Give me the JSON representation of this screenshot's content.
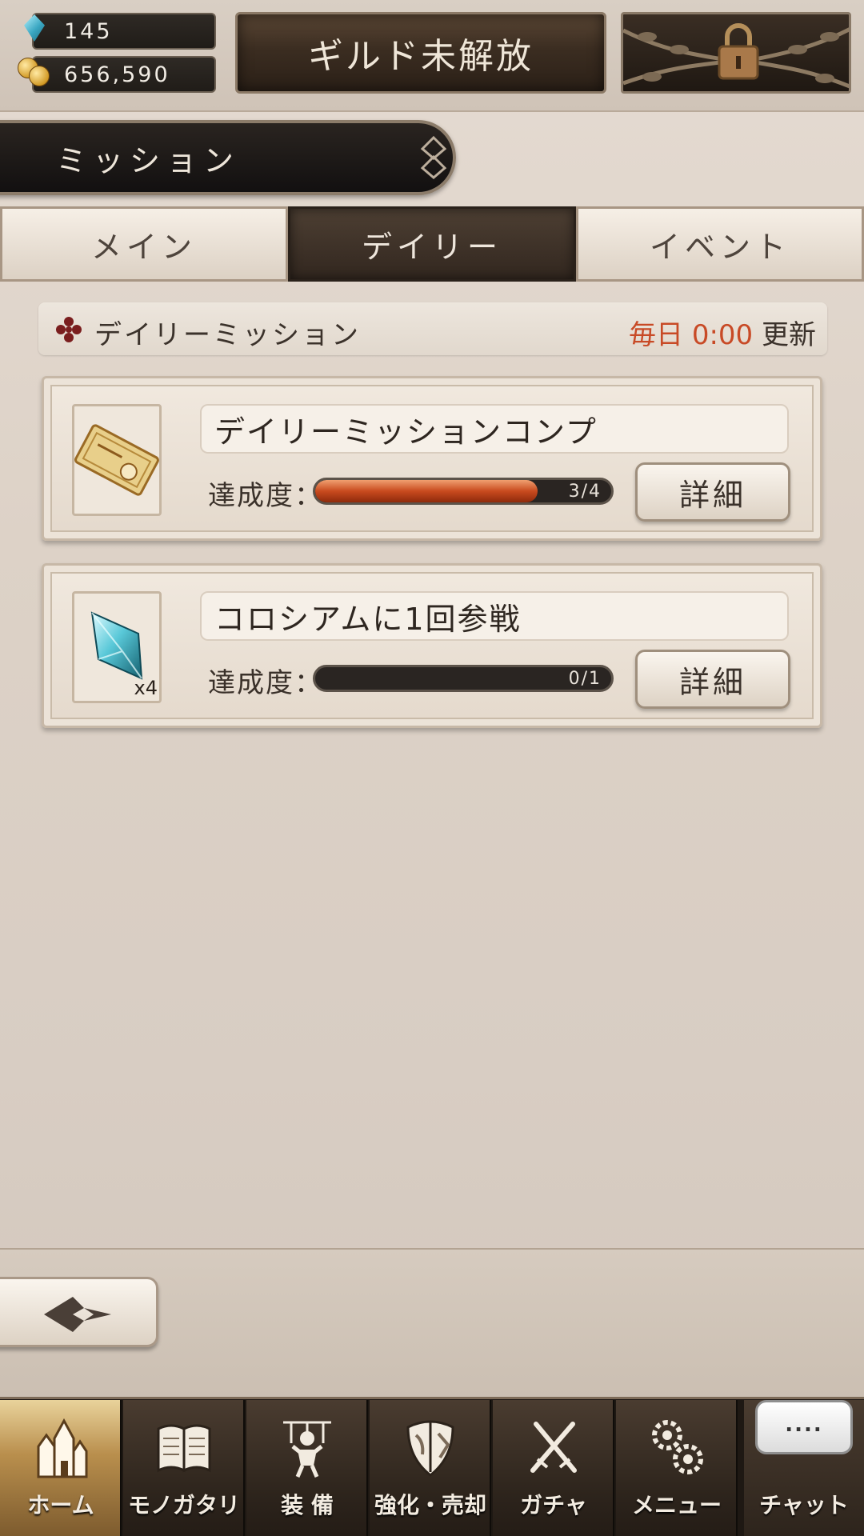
{
  "header": {
    "gems": "145",
    "coins": "656,590",
    "guild_button_label": "ギルド未解放"
  },
  "mission_header": {
    "title": "ミッション"
  },
  "tabs": [
    {
      "label": "メイン",
      "active": false
    },
    {
      "label": "デイリー",
      "active": true
    },
    {
      "label": "イベント",
      "active": false
    }
  ],
  "section": {
    "title": "デイリーミッション",
    "reset_prefix": "毎日",
    "reset_time": "0:00",
    "reset_suffix": "更新"
  },
  "missions": [
    {
      "title": "デイリーミッションコンプ",
      "progress_label": "達成度：",
      "progress_text": "3/4",
      "progress_fraction": 0.75,
      "reward_icon": "ticket-icon",
      "reward_qty": "",
      "detail_label": "詳細"
    },
    {
      "title": "コロシアムに1回参戦",
      "progress_label": "達成度：",
      "progress_text": "0/1",
      "progress_fraction": 0,
      "reward_icon": "crystal-icon",
      "reward_qty": "x4",
      "detail_label": "詳細"
    }
  ],
  "nav": [
    {
      "label": "ホーム",
      "icon": "castle-icon",
      "active": true
    },
    {
      "label": "モノガタリ",
      "icon": "book-icon",
      "active": false
    },
    {
      "label": "装 備",
      "icon": "marionette-icon",
      "active": false
    },
    {
      "label": "強化・売却",
      "icon": "shield-icon",
      "active": false
    },
    {
      "label": "ガチャ",
      "icon": "swords-icon",
      "active": false
    },
    {
      "label": "メニュー",
      "icon": "gears-icon",
      "active": false
    }
  ],
  "chat": {
    "bubble": "....",
    "label": "チャット"
  }
}
